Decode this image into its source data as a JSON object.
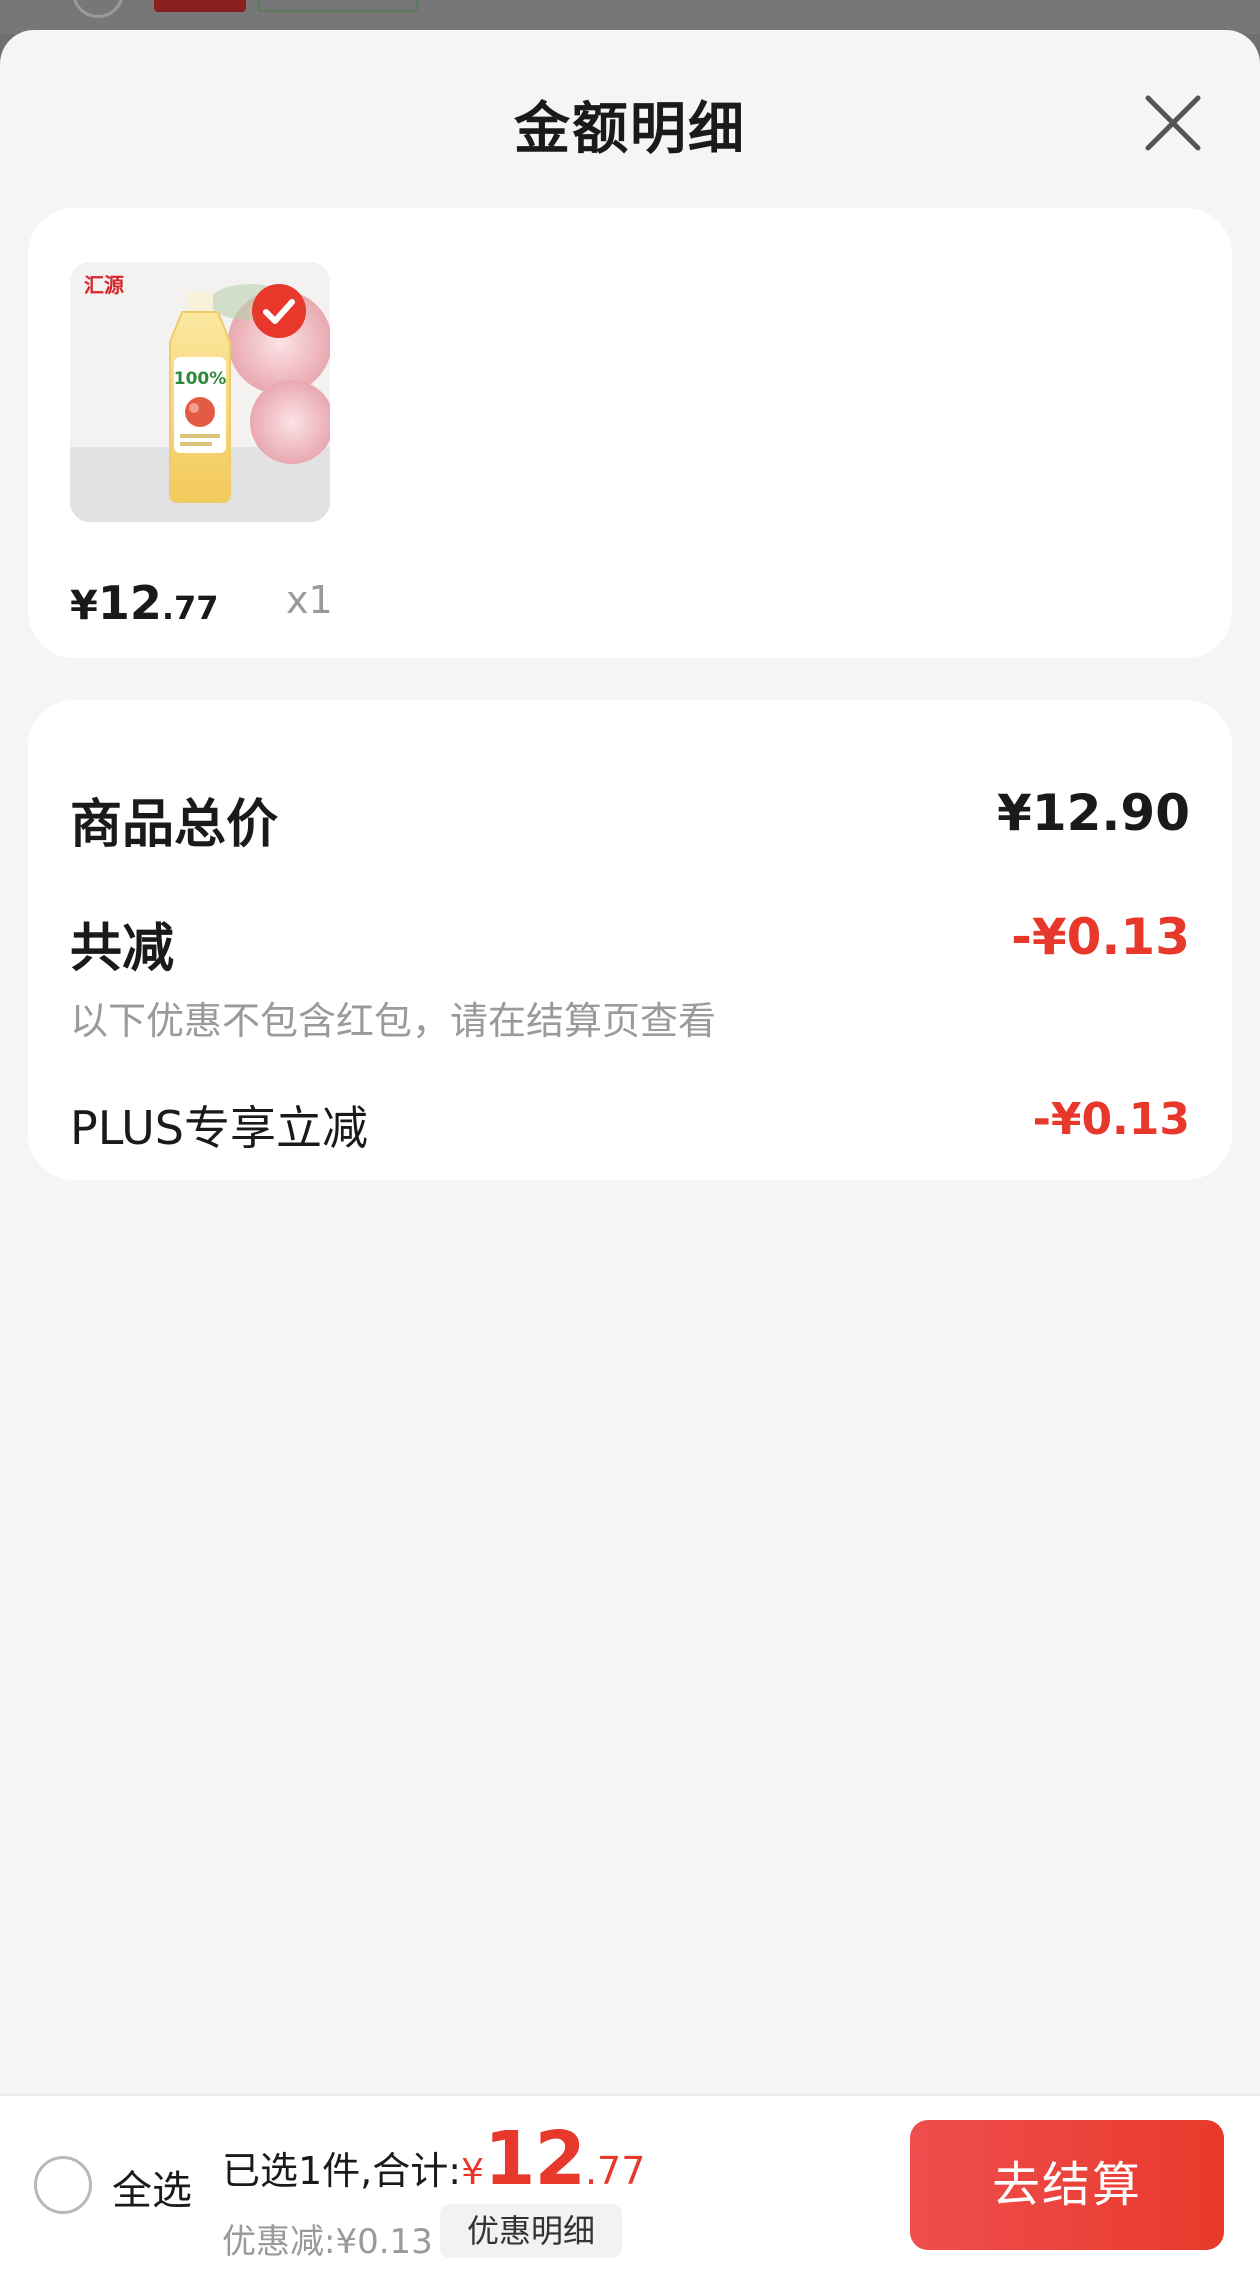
{
  "sheet": {
    "title": "金额明细",
    "close_icon": "close-icon"
  },
  "product": {
    "price_symbol": "¥",
    "price_int": "12",
    "price_dec": ".77",
    "qty": "x1",
    "brand_logo_text": "汇源",
    "bottle_label": "100%",
    "check_icon": "check-circle-icon",
    "selected": true
  },
  "summary": {
    "total_label": "商品总价",
    "total_value": "¥12.90",
    "discount_label": "共减",
    "discount_value": "-¥0.13",
    "discount_note": "以下优惠不包含红包，请在结算页查看",
    "plus_label": "PLUS专享立减",
    "plus_value": "-¥0.13"
  },
  "bottom_bar": {
    "select_all_label": "全选",
    "selected_text": "已选1件,合计:",
    "total_symbol": "¥",
    "total_int": "12",
    "total_dec": ".77",
    "discount_text": "优惠减:¥0.13",
    "discount_detail_button": "优惠明细",
    "checkout_button": "去结算"
  },
  "colors": {
    "accent_red": "#e8372b",
    "sheet_bg": "#f5f5f5",
    "card_bg": "#ffffff"
  }
}
